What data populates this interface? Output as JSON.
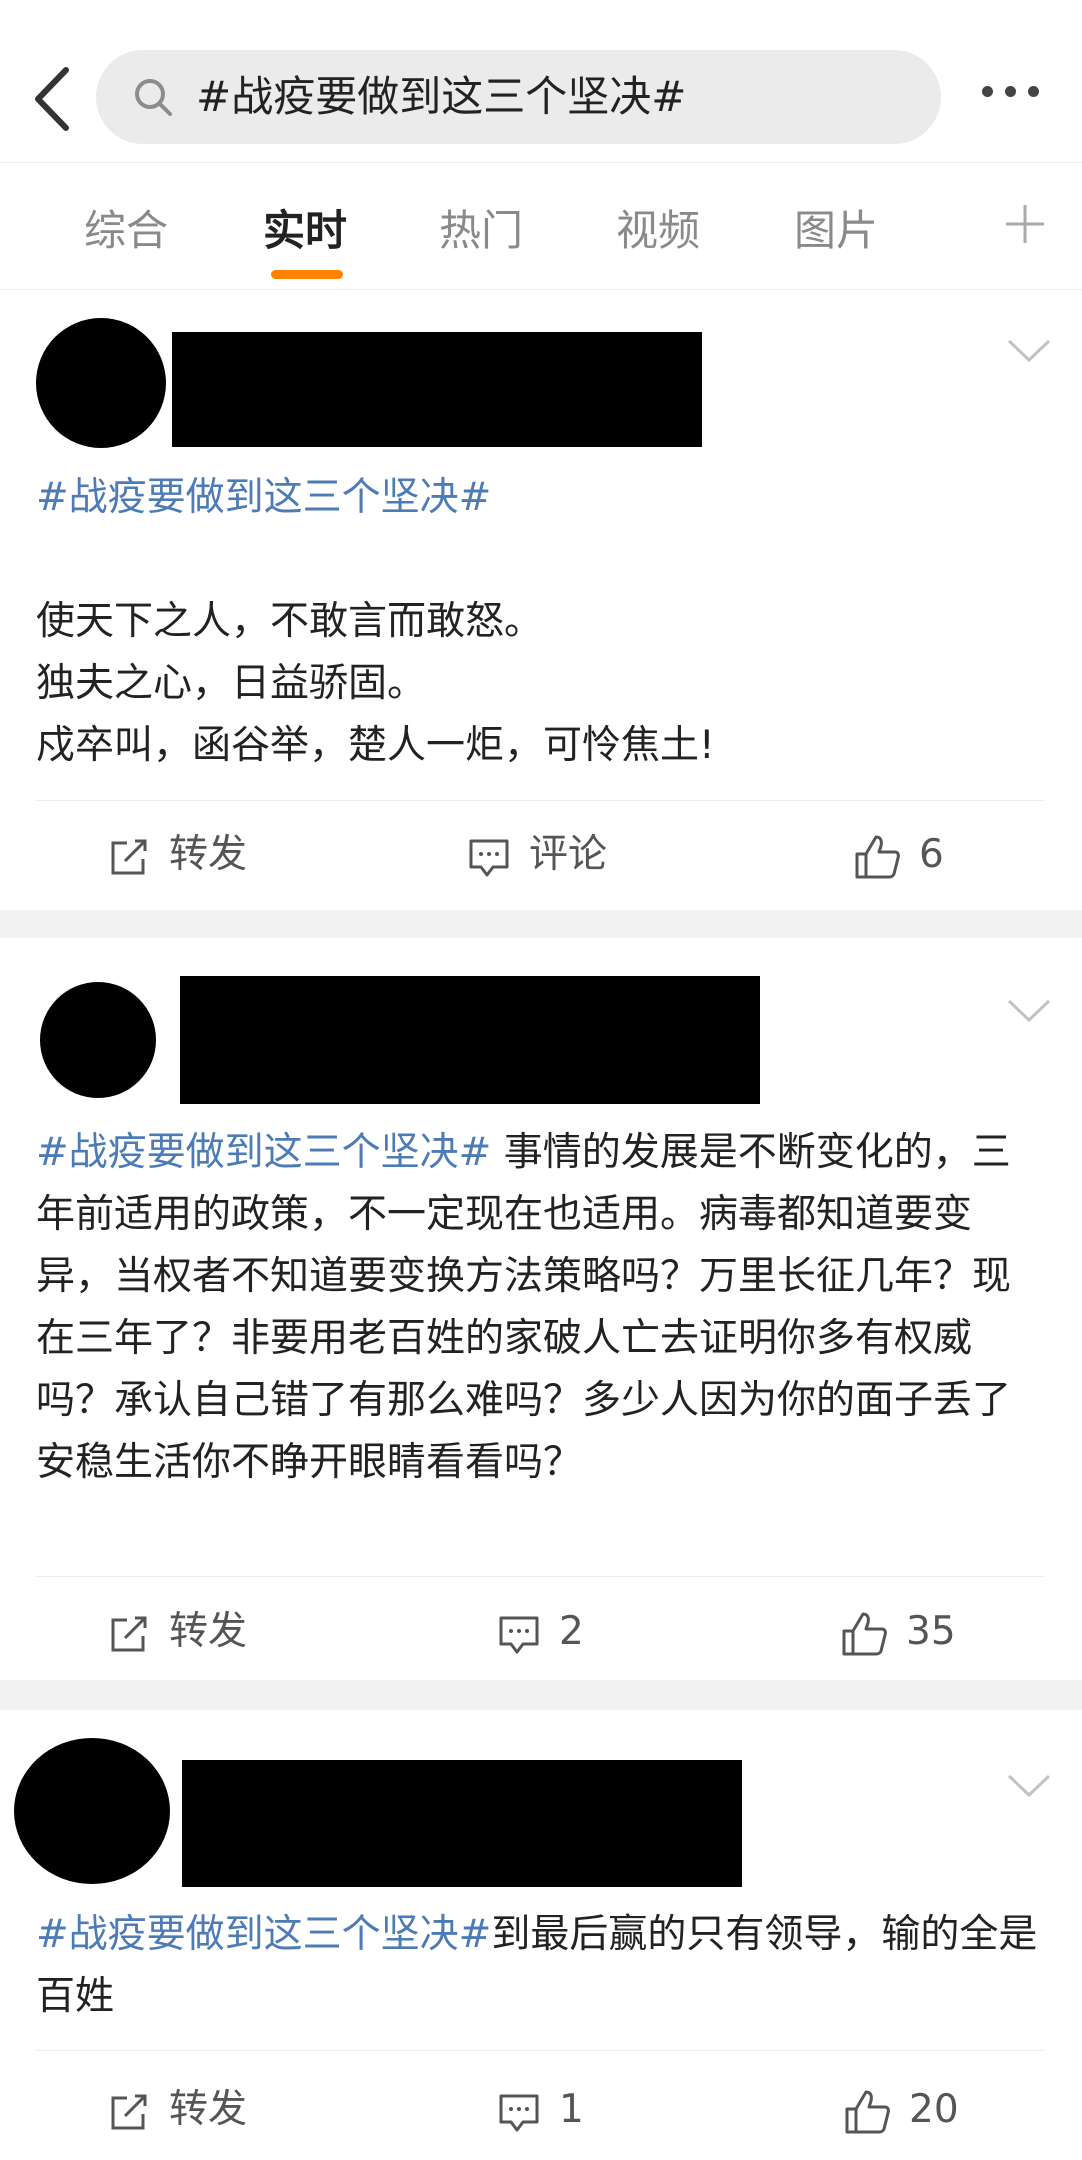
{
  "search": {
    "query": "#战疫要做到这三个坚决#"
  },
  "tabs": [
    {
      "label": "综合"
    },
    {
      "label": "实时"
    },
    {
      "label": "热门"
    },
    {
      "label": "视频"
    },
    {
      "label": "图片"
    }
  ],
  "active_tab": "实时",
  "colors": {
    "accent": "#ff8200",
    "hashtag": "#4d7bb5",
    "separator": "#f2f2f2"
  },
  "posts": [
    {
      "hashtag": "#战疫要做到这三个坚决#",
      "text": "\n\n使天下之人，不敢言而敢怒。\n独夫之心，日益骄固。\n戍卒叫，函谷举，楚人一炬，可怜焦土!",
      "repost": "转发",
      "comment": "评论",
      "likes": "6"
    },
    {
      "hashtag": "#战疫要做到这三个坚决#",
      "text": " 事情的发展是不断变化的，三年前适用的政策，不一定现在也适用。病毒都知道要变异，当权者不知道要变换方法策略吗？万里长征几年？现在三年了？非要用老百姓的家破人亡去证明你多有权威吗？承认自己错了有那么难吗？多少人因为你的面子丢了安稳生活你不睁开眼睛看看吗？",
      "repost": "转发",
      "comment": "2",
      "likes": "35"
    },
    {
      "hashtag": "#战疫要做到这三个坚决#",
      "text": "到最后赢的只有领导，输的全是百姓",
      "repost": "转发",
      "comment": "1",
      "likes": "20"
    }
  ]
}
